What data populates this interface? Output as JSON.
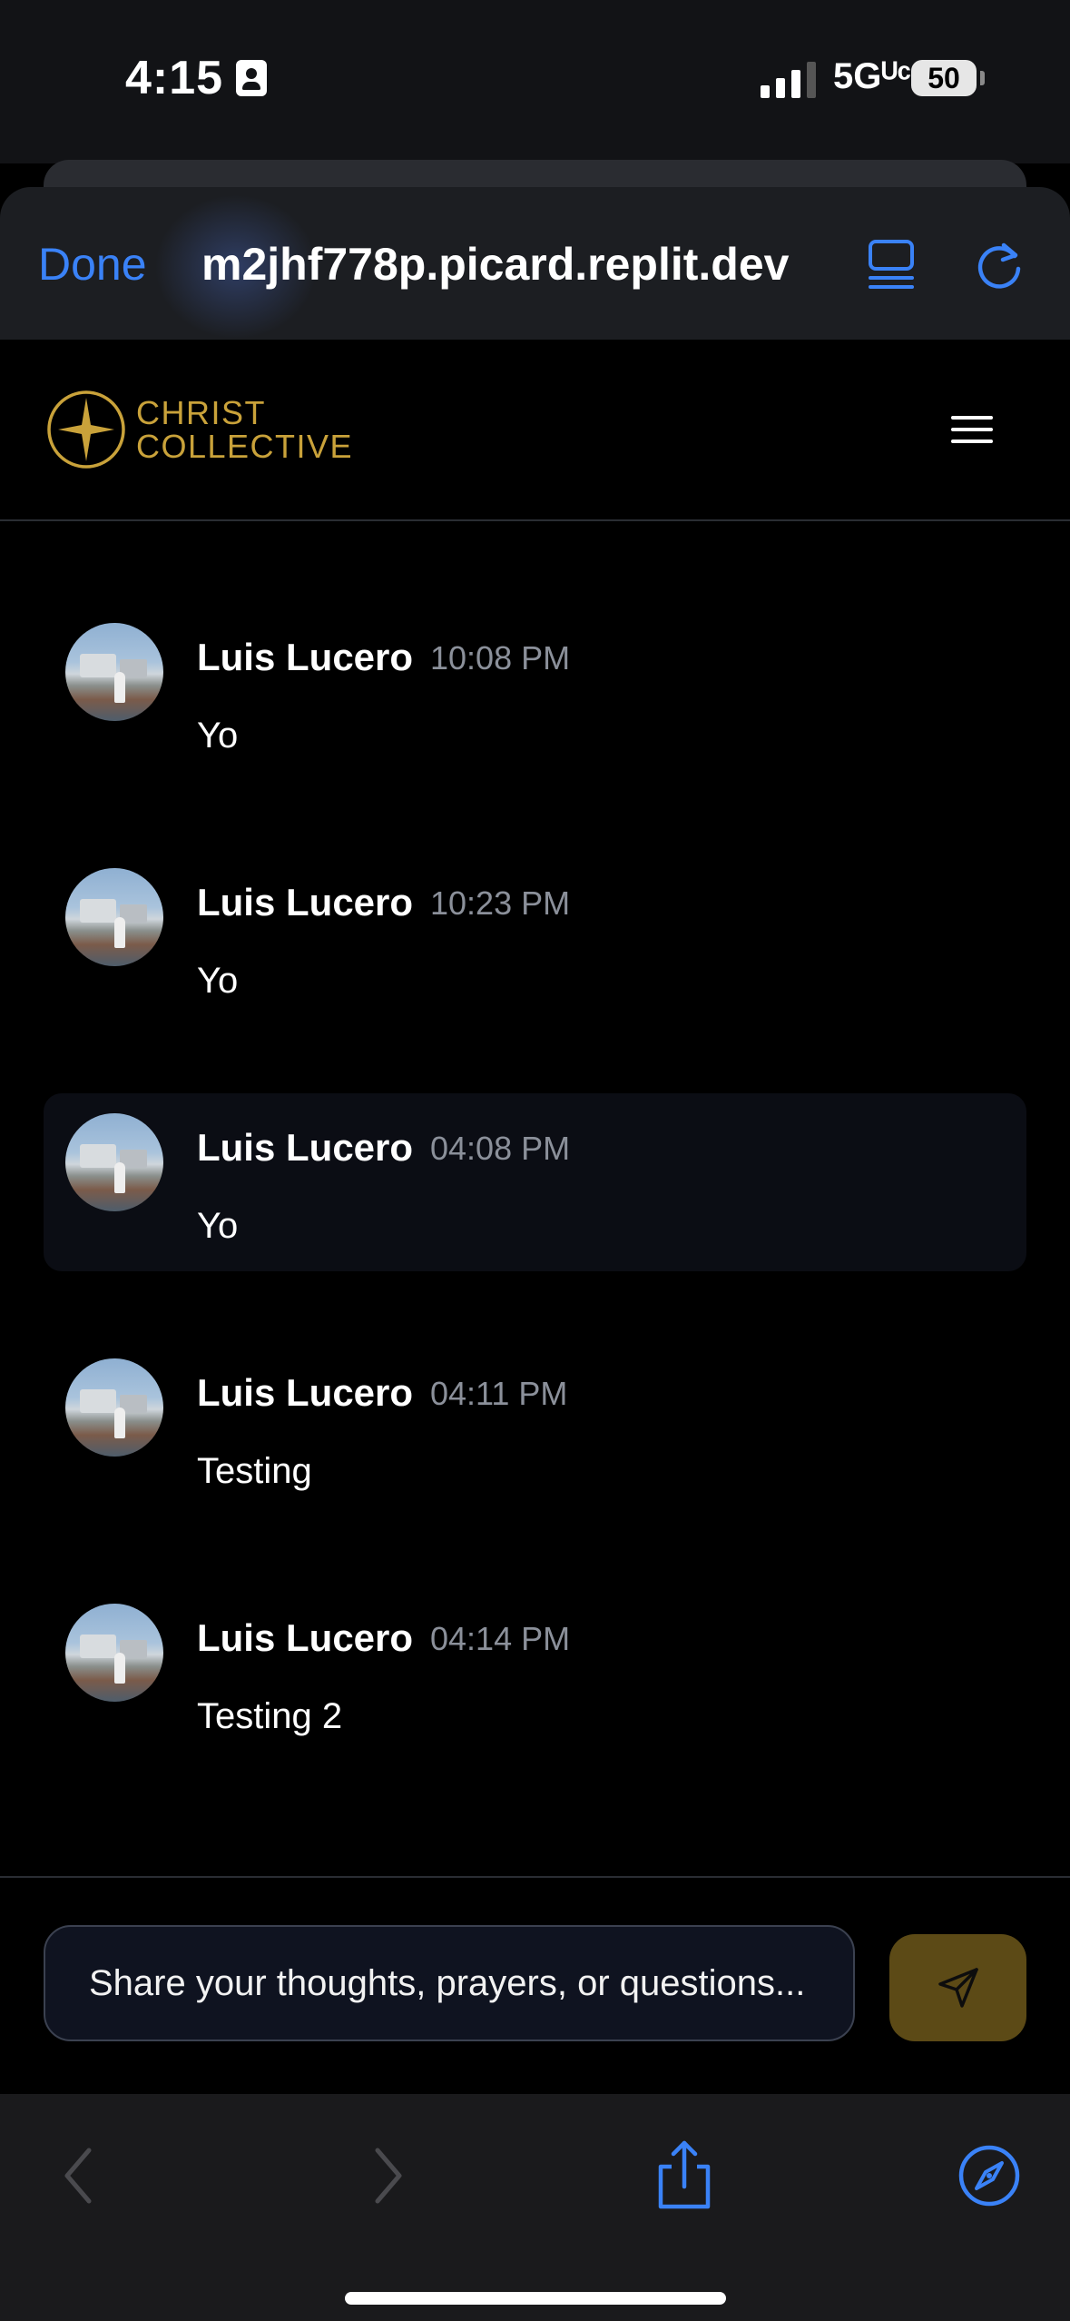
{
  "status_bar": {
    "time": "4:15",
    "network": "5Gᵁᶜ",
    "battery": "50"
  },
  "browser": {
    "done_label": "Done",
    "url": "m2jhf778p.picard.replit.dev",
    "accent_color": "#3a82f7"
  },
  "app": {
    "brand_line1": "CHRIST",
    "brand_line2": "COLLECTIVE",
    "brand_color": "#c9a23a"
  },
  "messages": [
    {
      "author": "Luis Lucero",
      "time": "10:08 PM",
      "text": "Yo",
      "highlighted": false
    },
    {
      "author": "Luis Lucero",
      "time": "10:23 PM",
      "text": "Yo",
      "highlighted": false
    },
    {
      "author": "Luis Lucero",
      "time": "04:08 PM",
      "text": "Yo",
      "highlighted": true
    },
    {
      "author": "Luis Lucero",
      "time": "04:11 PM",
      "text": "Testing",
      "highlighted": false
    },
    {
      "author": "Luis Lucero",
      "time": "04:14 PM",
      "text": "Testing 2",
      "highlighted": false
    }
  ],
  "composer": {
    "placeholder": "Share your thoughts, prayers, or questions...",
    "send_icon": "send-icon"
  },
  "toolbar": {
    "icons": [
      "back-icon",
      "forward-icon",
      "share-icon",
      "compass-icon"
    ]
  }
}
